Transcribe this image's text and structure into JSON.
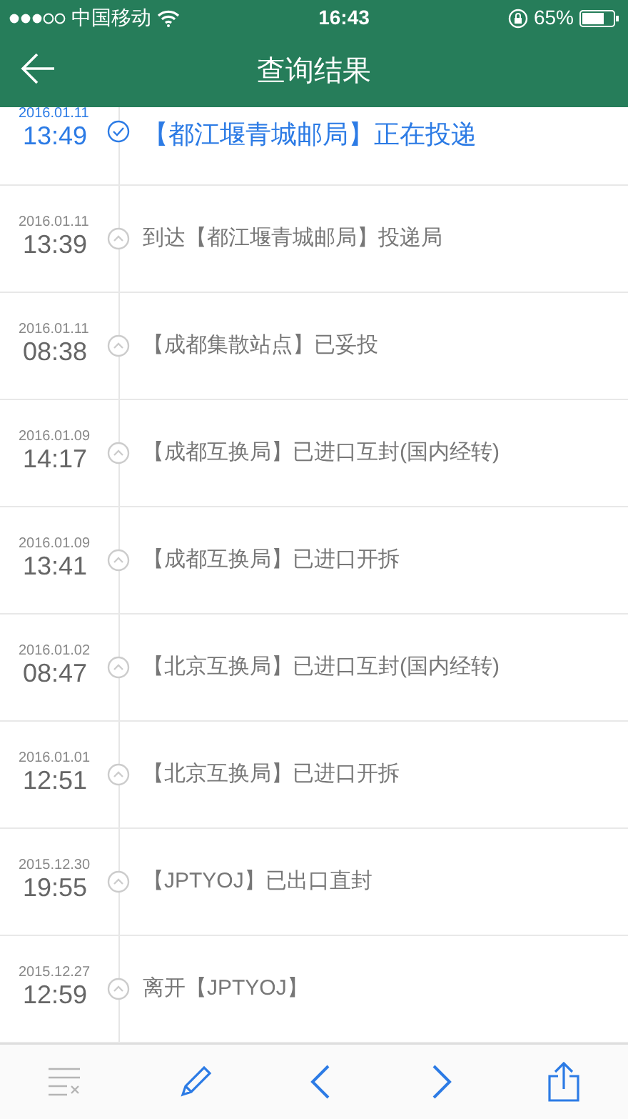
{
  "status_bar": {
    "carrier": "中国移动",
    "time": "16:43",
    "battery": "65%"
  },
  "nav": {
    "title": "查询结果"
  },
  "events": [
    {
      "date": "2016.01.11",
      "time": "13:49",
      "text": "【都江堰青城邮局】正在投递",
      "current": true
    },
    {
      "date": "2016.01.11",
      "time": "13:39",
      "text": "到达【都江堰青城邮局】投递局",
      "current": false
    },
    {
      "date": "2016.01.11",
      "time": "08:38",
      "text": "【成都集散站点】已妥投",
      "current": false
    },
    {
      "date": "2016.01.09",
      "time": "14:17",
      "text": "【成都互换局】已进口互封(国内经转)",
      "current": false
    },
    {
      "date": "2016.01.09",
      "time": "13:41",
      "text": "【成都互换局】已进口开拆",
      "current": false
    },
    {
      "date": "2016.01.02",
      "time": "08:47",
      "text": "【北京互换局】已进口互封(国内经转)",
      "current": false
    },
    {
      "date": "2016.01.01",
      "time": "12:51",
      "text": "【北京互换局】已进口开拆",
      "current": false
    },
    {
      "date": "2015.12.30",
      "time": "19:55",
      "text": "【JPTYOJ】已出口直封",
      "current": false
    },
    {
      "date": "2015.12.27",
      "time": "12:59",
      "text": "离开【JPTYOJ】",
      "current": false
    }
  ],
  "toolbar": [
    {
      "kind": "clear",
      "disabled": true
    },
    {
      "kind": "edit",
      "disabled": false
    },
    {
      "kind": "back",
      "disabled": false
    },
    {
      "kind": "forward",
      "disabled": false
    },
    {
      "kind": "share",
      "disabled": false
    }
  ]
}
